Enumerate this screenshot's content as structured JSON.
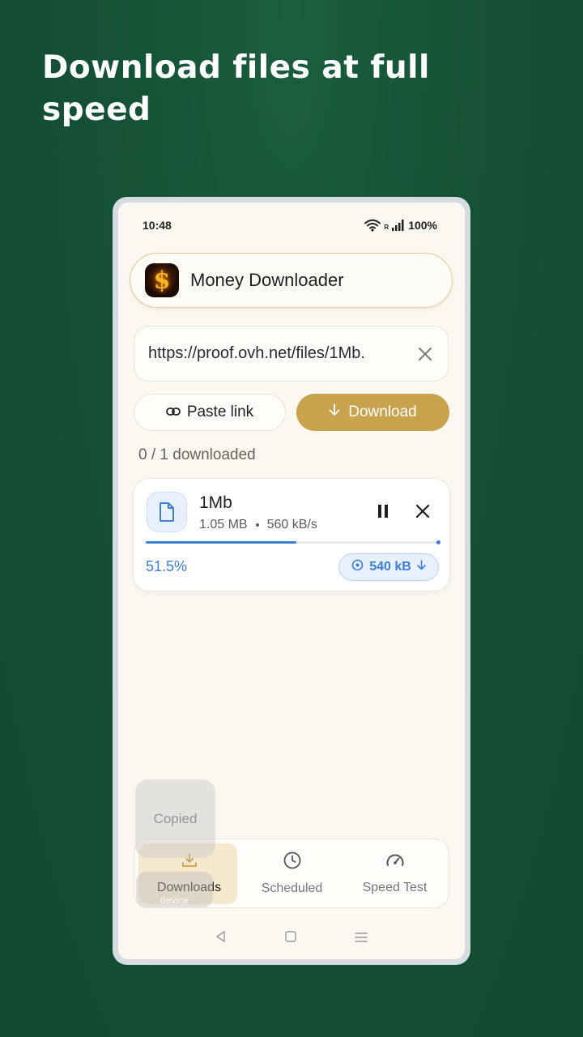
{
  "headline": "Download files at full speed",
  "status_bar": {
    "time": "10:48",
    "roaming_indicator": "R",
    "battery": "100%",
    "icons": [
      "wifi-icon",
      "signal-icon"
    ]
  },
  "app": {
    "title": "Money Downloader",
    "logo_symbol": "$"
  },
  "url_input": {
    "value": "https://proof.ovh.net/files/1Mb.",
    "clear_icon": "close-icon"
  },
  "actions": {
    "paste_label": "Paste link",
    "download_label": "Download",
    "accent_color": "#c9a24e"
  },
  "summary": {
    "downloaded_text": "0 / 1 downloaded"
  },
  "download_item": {
    "name": "1Mb",
    "size": "1.05 MB",
    "speed": "560 kB/s",
    "progress": 51.5,
    "progress_label": "51.5%",
    "speed_chip": "540 kB",
    "progress_color": "#3b7fd8"
  },
  "toast": {
    "text": "Copied",
    "secondary_text": "device"
  },
  "bottom_nav": {
    "items": [
      {
        "label": "Downloads",
        "icon": "download-tray-icon",
        "active": true
      },
      {
        "label": "Scheduled",
        "icon": "clock-icon",
        "active": false
      },
      {
        "label": "Speed Test",
        "icon": "speedometer-icon",
        "active": false
      }
    ]
  },
  "system_nav": [
    "back-icon",
    "home-icon",
    "recents-icon"
  ]
}
